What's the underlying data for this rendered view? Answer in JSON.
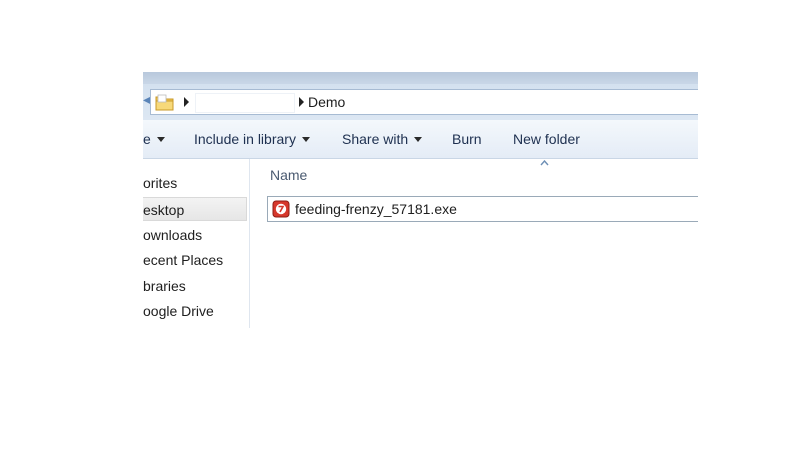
{
  "address_bar": {
    "current_folder": "Demo"
  },
  "toolbar": {
    "organize_label": "e",
    "include_label": "Include in library",
    "share_label": "Share with",
    "burn_label": "Burn",
    "new_folder_label": "New folder"
  },
  "sidebar": {
    "items": [
      {
        "label": "orites"
      },
      {
        "label": "esktop"
      },
      {
        "label": "ownloads"
      },
      {
        "label": "ecent Places"
      },
      {
        "label": "braries"
      },
      {
        "label": "oogle Drive"
      }
    ]
  },
  "file_list": {
    "column_name": "Name",
    "files": [
      {
        "name": "feeding-frenzy_57181.exe",
        "icon": "exe-app-icon"
      }
    ]
  },
  "colors": {
    "toolbar_text": "#1e3050",
    "address_border": "#a7bbd3",
    "icon_red": "#d6382c",
    "folder_yellow": "#f2c552"
  }
}
